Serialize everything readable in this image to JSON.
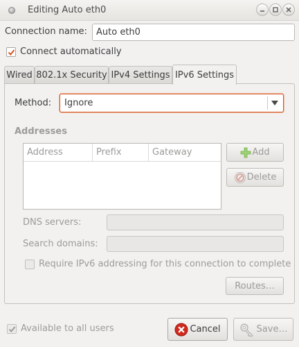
{
  "window": {
    "title": "Editing Auto eth0"
  },
  "connection_name": {
    "label": "Connection name:",
    "value": "Auto eth0"
  },
  "connect_automatically": {
    "label": "Connect automatically",
    "checked": true
  },
  "tabs": [
    {
      "label": "Wired"
    },
    {
      "label": "802.1x Security"
    },
    {
      "label": "IPv4 Settings"
    },
    {
      "label": "IPv6 Settings",
      "active": true
    }
  ],
  "method": {
    "label": "Method:",
    "value": "Ignore"
  },
  "addresses": {
    "heading": "Addresses",
    "columns": [
      "Address",
      "Prefix",
      "Gateway"
    ],
    "add_label": "Add",
    "delete_label": "Delete"
  },
  "dns_servers": {
    "label": "DNS servers:",
    "value": ""
  },
  "search_domains": {
    "label": "Search domains:",
    "value": ""
  },
  "require_ipv6": {
    "label": "Require IPv6 addressing for this connection to complete",
    "checked": false
  },
  "routes_label": "Routes…",
  "available_all_users": {
    "label": "Available to all users",
    "checked": true
  },
  "cancel_label": "Cancel",
  "save_label": "Save…",
  "colors": {
    "accent": "#d9531e",
    "cancel_icon": "#d0291e",
    "add_icon": "#6fb33f"
  }
}
